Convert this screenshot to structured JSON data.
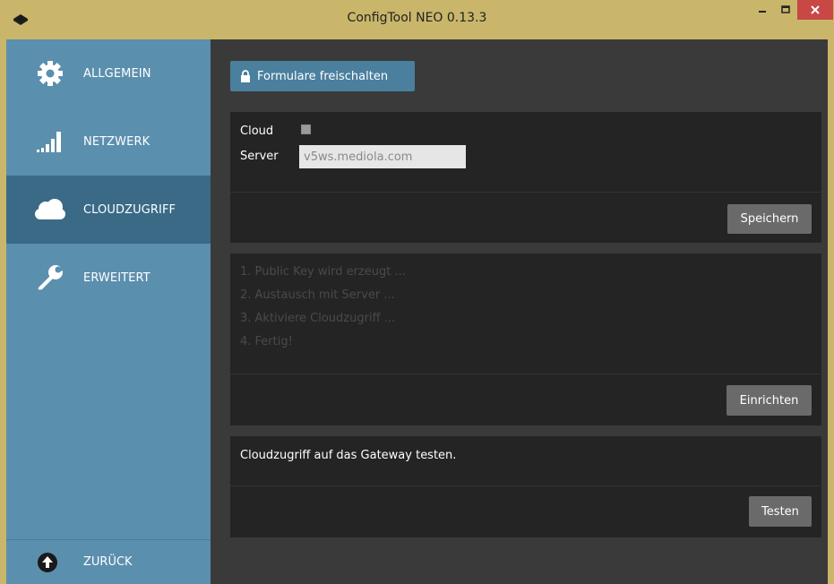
{
  "window": {
    "title": "ConfigTool NEO 0.13.3",
    "accent": "#c9b66a",
    "close_color": "#c74845"
  },
  "sidebar": {
    "bg": "#5b8fae",
    "active_bg": "#3a6a86",
    "items": [
      {
        "label": "ALLGEMEIN",
        "icon": "gear-icon",
        "active": false
      },
      {
        "label": "NETZWERK",
        "icon": "signal-bars-icon",
        "active": false
      },
      {
        "label": "CLOUDZUGRIFF",
        "icon": "cloud-icon",
        "active": true
      },
      {
        "label": "ERWEITERT",
        "icon": "wrench-icon",
        "active": false
      }
    ],
    "back": {
      "label": "ZURÜCK",
      "icon": "arrow-up-circle-icon"
    }
  },
  "main": {
    "unlock_button": {
      "label": "Formulare freischalten",
      "icon": "lock-icon"
    },
    "cloud_panel": {
      "cloud_label": "Cloud",
      "cloud_checked": false,
      "server_label": "Server",
      "server_value": "v5ws.mediola.com",
      "save_label": "Speichern"
    },
    "setup_panel": {
      "steps": [
        "1. Public Key wird erzeugt ...",
        "2. Austausch mit Server ...",
        "3. Aktiviere Cloudzugriff ...",
        "4. Fertig!"
      ],
      "setup_label": "Einrichten"
    },
    "test_panel": {
      "message": "Cloudzugriff auf das Gateway testen.",
      "test_label": "Testen"
    }
  }
}
